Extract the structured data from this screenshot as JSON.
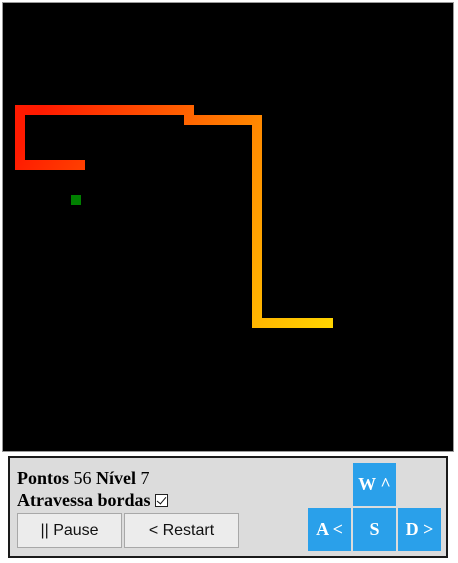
{
  "board": {
    "background": "#000000",
    "snake_head_color": "#ffd700",
    "snake_tail_color": "#ff2200",
    "food_color": "#008000"
  },
  "stats": {
    "score_label": "Pontos",
    "score_value": "56",
    "level_label": "Nível",
    "level_value": "7",
    "wrap_label": "Atravessa bordas",
    "wrap_checked": true
  },
  "controls": {
    "pause_label": "|| Pause",
    "restart_label": "< Restart"
  },
  "keys": {
    "up": "W ^",
    "left": "A <",
    "down": "S",
    "right": "D >",
    "color": "#2aa0ea"
  }
}
